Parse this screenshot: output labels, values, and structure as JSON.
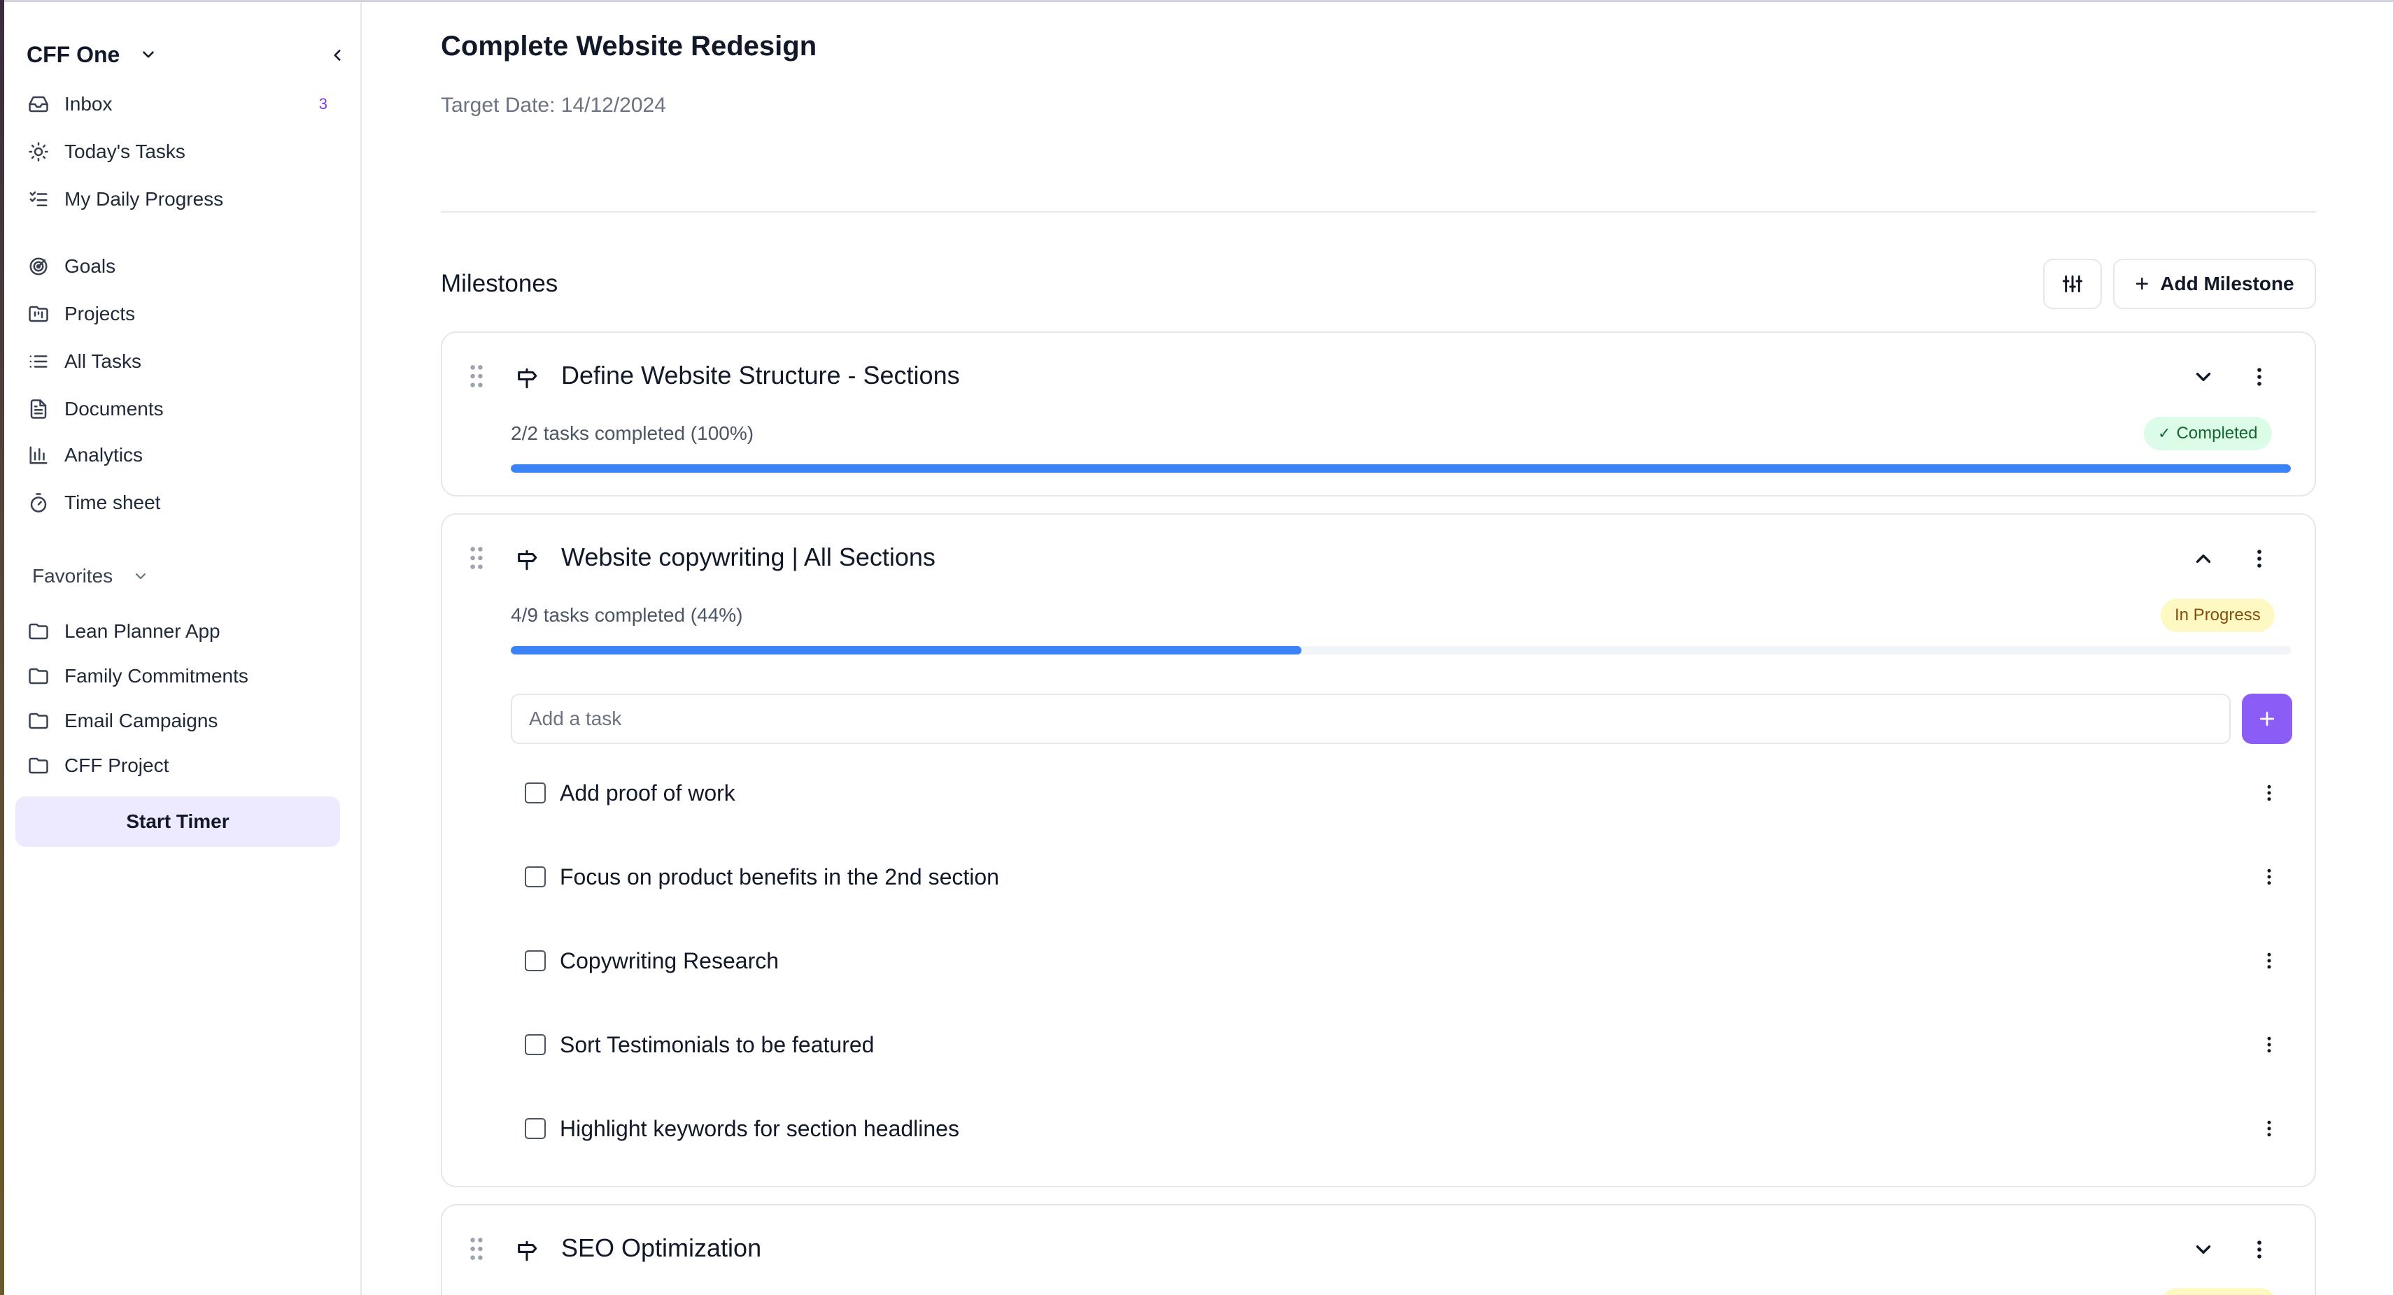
{
  "sidebar": {
    "workspace": "CFF One",
    "nav": [
      {
        "label": "Inbox",
        "icon": "inbox-icon",
        "badge": "3"
      },
      {
        "label": "Today's Tasks",
        "icon": "sun-icon"
      },
      {
        "label": "My Daily Progress",
        "icon": "checklist-icon"
      },
      {
        "label": "Goals",
        "icon": "target-icon"
      },
      {
        "label": "Projects",
        "icon": "folder-kanban-icon"
      },
      {
        "label": "All Tasks",
        "icon": "list-icon"
      },
      {
        "label": "Documents",
        "icon": "document-icon"
      },
      {
        "label": "Analytics",
        "icon": "bar-chart-icon"
      },
      {
        "label": "Time sheet",
        "icon": "timer-icon"
      }
    ],
    "favorites_label": "Favorites",
    "favorites": [
      {
        "label": "Lean Planner App",
        "icon": "folder-icon"
      },
      {
        "label": "Family Commitments",
        "icon": "folder-icon"
      },
      {
        "label": "Email Campaigns",
        "icon": "folder-icon"
      },
      {
        "label": "CFF Project",
        "icon": "folder-icon"
      }
    ],
    "start_timer": "Start Timer"
  },
  "main": {
    "title": "Complete Website Redesign",
    "target_date": "Target Date: 14/12/2024",
    "milestones_title": "Milestones",
    "add_milestone": "Add Milestone",
    "milestones": [
      {
        "title": "Define Website Structure - Sections",
        "progress_text": "2/2 tasks completed (100%)",
        "progress": 1.0,
        "status": "Completed",
        "status_color": "#dcfce7",
        "expanded": false
      },
      {
        "title": "Website copywriting | All Sections",
        "progress_text": "4/9 tasks completed (44%)",
        "progress": 0.444,
        "status": "In Progress",
        "status_color": "#fef9c3",
        "expanded": true,
        "add_task_placeholder": "Add a task",
        "tasks": [
          {
            "label": "Add proof of work",
            "checked": false
          },
          {
            "label": "Focus on product benefits in the 2nd section",
            "checked": false
          },
          {
            "label": "Copywriting Research",
            "checked": false
          },
          {
            "label": "Sort Testimonials to be featured",
            "checked": false
          },
          {
            "label": "Highlight keywords for section headlines",
            "checked": false
          }
        ]
      },
      {
        "title": "SEO Optimization",
        "expanded": false
      }
    ]
  },
  "colors": {
    "accent": "#8b5cf6",
    "progress": "#3b82f6",
    "badge": "#7c3aed"
  }
}
